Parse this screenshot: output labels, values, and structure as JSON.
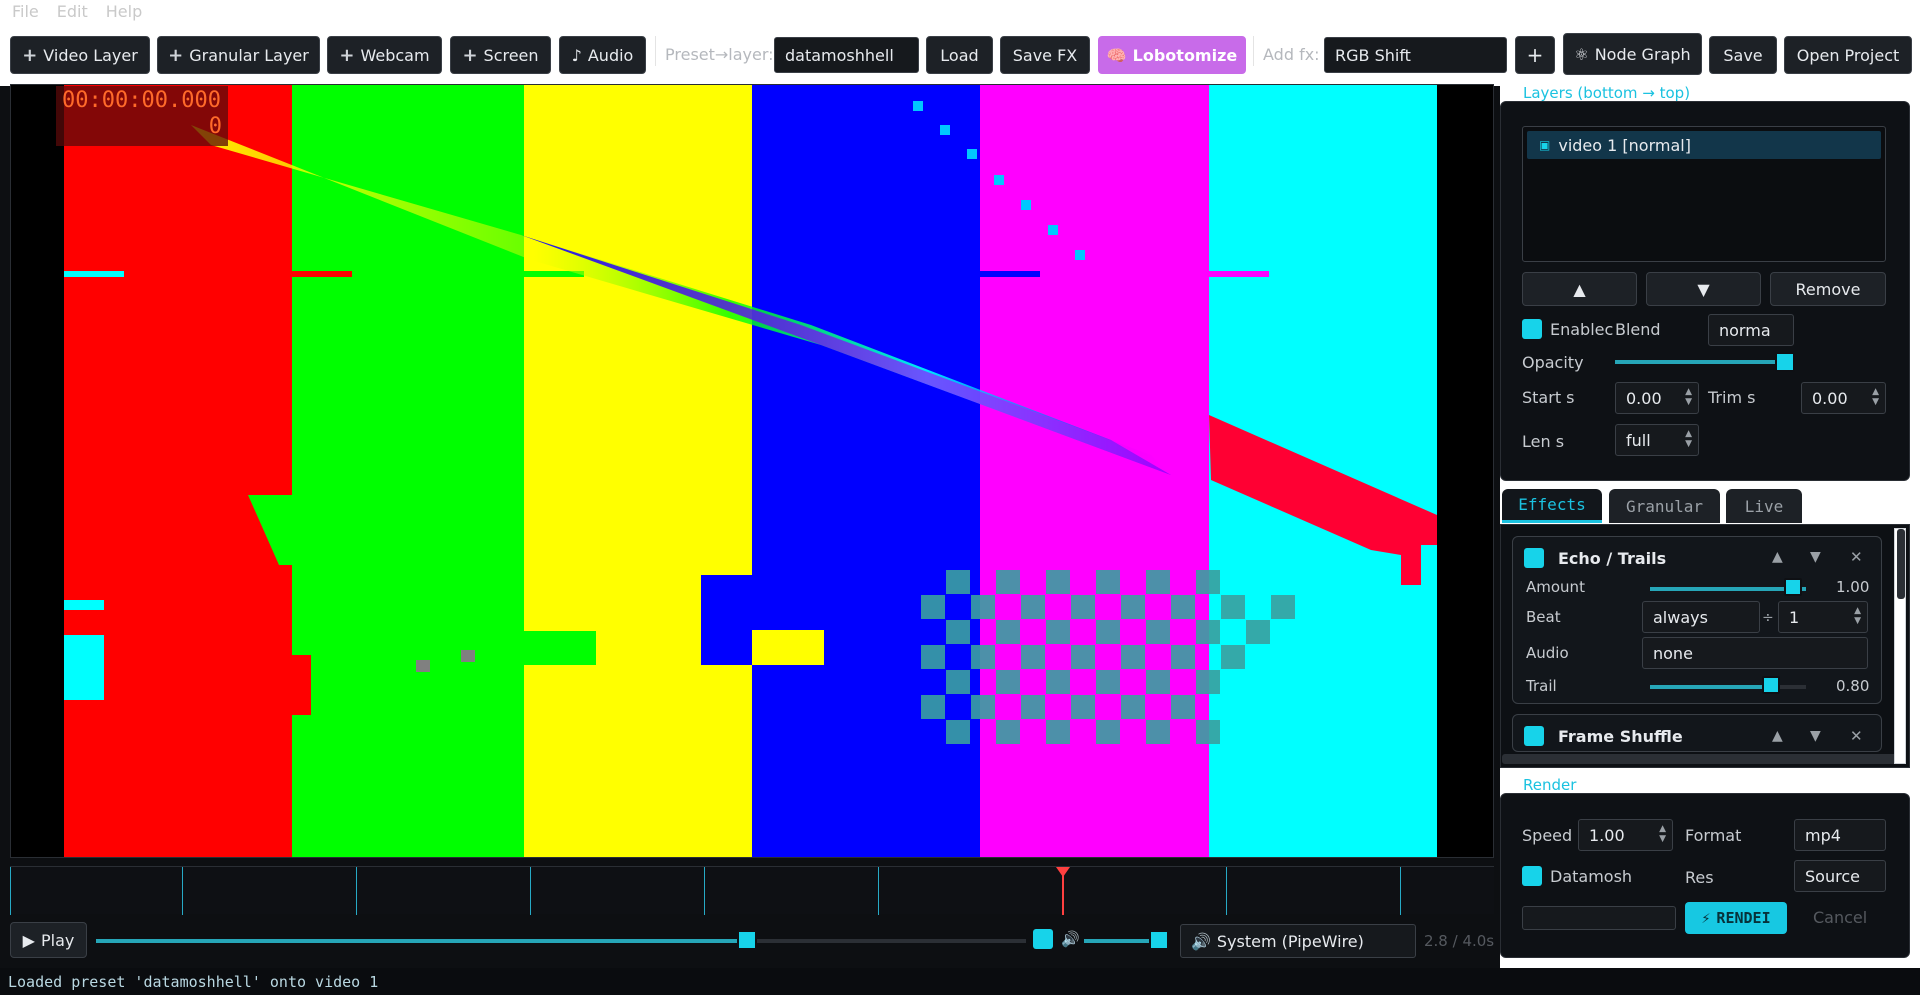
{
  "menu": [
    "File",
    "Edit",
    "Help"
  ],
  "toolbar": {
    "video_layer": "Video Layer",
    "granular_layer": "Granular Layer",
    "webcam": "Webcam",
    "screen": "Screen",
    "audio": "Audio",
    "preset_label": "Preset→layer:",
    "preset_value": "datamoshhell",
    "load": "Load",
    "save_fx": "Save FX",
    "lobotomize": "Lobotomize",
    "add_fx_label": "Add fx:",
    "add_fx_value": "RGB Shift",
    "add": "+",
    "node_graph": "Node Graph",
    "save": "Save",
    "open_project": "Open Project"
  },
  "viewer": {
    "timecode": "00:00:00.000",
    "frame": "0",
    "colors": {
      "red": "#ff0000",
      "green": "#00ff00",
      "yellow": "#ffff00",
      "blue": "#0000ff",
      "magenta": "#ff00ff",
      "cyan": "#00ffff"
    }
  },
  "transport": {
    "play": "Play",
    "seek_fraction": 0.7,
    "volume_fraction": 0.85,
    "audio_device": "System (PipeWire)",
    "time": "2.8 / 4.0s"
  },
  "status": "Loaded preset 'datamoshhell' onto video 1",
  "layers": {
    "title": "Layers  (bottom → top)",
    "items": [
      "video 1  [normal]"
    ],
    "up": "▲",
    "down": "▼",
    "remove": "Remove",
    "enabled": "Enablec",
    "blend_label": "Blend",
    "blend_value": "norma",
    "opacity_label": "Opacity",
    "opacity_fraction": 1.0,
    "start_label": "Start s",
    "start_value": "0.00",
    "trim_label": "Trim s",
    "trim_value": "0.00",
    "len_label": "Len s",
    "len_value": "full"
  },
  "tabs": [
    "Effects",
    "Granular",
    "Live"
  ],
  "effects": {
    "echo": {
      "title": "Echo / Trails",
      "amount_label": "Amount",
      "amount_value": "1.00",
      "beat_label": "Beat",
      "beat_value": "always",
      "beat_div": "1",
      "audio_label": "Audio",
      "audio_value": "none",
      "trail_label": "Trail",
      "trail_value": "0.80"
    },
    "shuffle": {
      "title": "Frame Shuffle"
    }
  },
  "render": {
    "title": "Render",
    "speed_label": "Speed",
    "speed_value": "1.00",
    "format_label": "Format",
    "format_value": "mp4",
    "datamosh": "Datamosh",
    "res_label": "Res",
    "res_value": "Source",
    "render_btn": "RENDEI",
    "cancel": "Cancel"
  }
}
